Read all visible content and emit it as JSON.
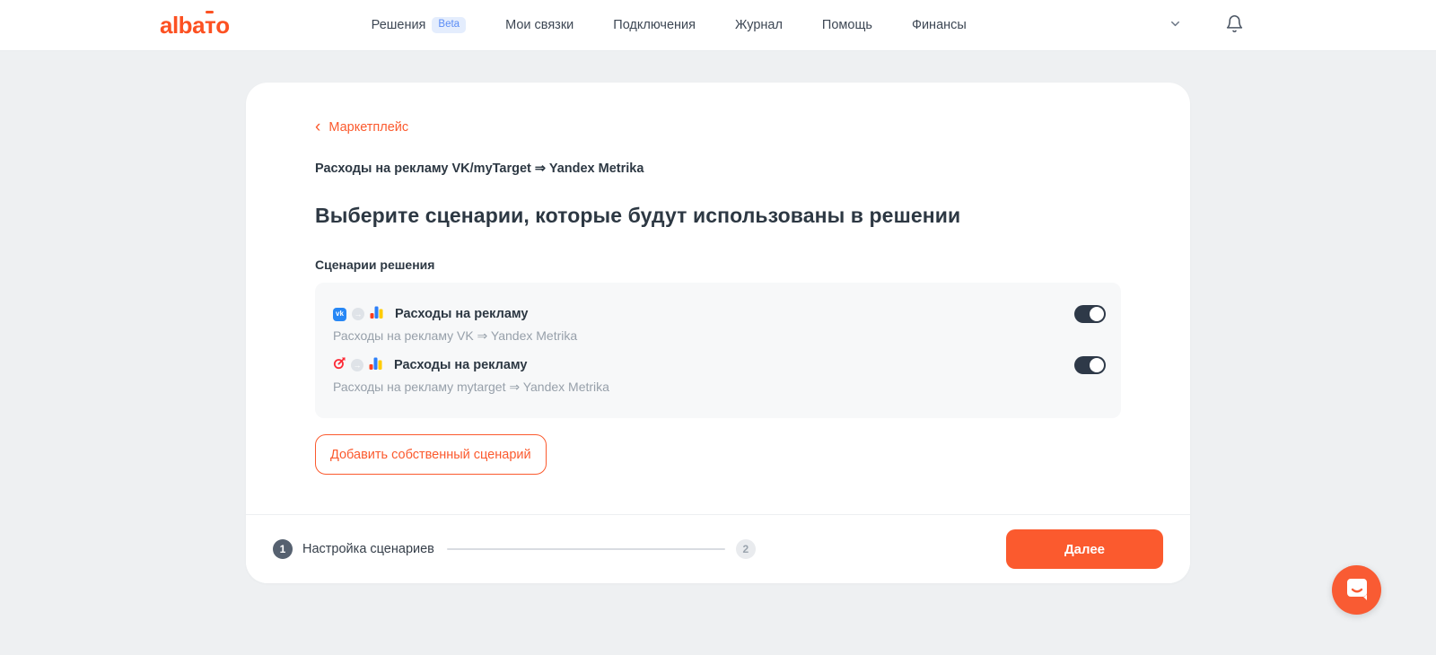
{
  "brand": {
    "logo_part1": "alba",
    "logo_t": "т",
    "logo_part2": "o"
  },
  "nav": {
    "items": [
      {
        "label": "Решения",
        "badge": "Beta"
      },
      {
        "label": "Мои связки"
      },
      {
        "label": "Подключения"
      },
      {
        "label": "Журнал"
      },
      {
        "label": "Помощь"
      },
      {
        "label": "Финансы"
      }
    ]
  },
  "page": {
    "back_label": "Маркетплейс",
    "back_chevron": "‹",
    "solution_title": "Расходы на рекламу VK/myTarget ⇒ Yandex Metrika",
    "heading": "Выберите сценарии, которые будут использованы в решении",
    "scenarios_label": "Сценарии решения",
    "scenarios": [
      {
        "source_app": "VK",
        "target_app": "Yandex Metrika",
        "title": "Расходы на рекламу",
        "subtitle": "Расходы на рекламу VK ⇒ Yandex Metrika",
        "enabled": true
      },
      {
        "source_app": "myTarget",
        "target_app": "Yandex Metrika",
        "title": "Расходы на рекламу",
        "subtitle": "Расходы на рекламу mytarget ⇒ Yandex Metrika",
        "enabled": true
      }
    ],
    "add_scenario_button": "Добавить собственный сценарий"
  },
  "footer": {
    "step1": {
      "number": "1",
      "label": "Настройка сценариев"
    },
    "step2": {
      "number": "2"
    },
    "next_button": "Далее"
  },
  "icons": {
    "vk_text": "vk",
    "transfer_arrow": "→"
  },
  "colors": {
    "accent_orange": "#fb5a2e",
    "logo_orange": "#fc5122",
    "page_background": "#eef0f2",
    "panel_background": "#f7f8f9",
    "toggle_on": "#2e3948",
    "vk_blue": "#2787f5",
    "metrika_red": "#fc3f1d",
    "metrika_blue": "#2d7ff9",
    "metrika_yellow": "#ffcc00",
    "mytarget_red": "#fc2c38",
    "beta_badge_bg": "#e4edfd",
    "beta_badge_text": "#5b8df5",
    "subtitle_gray": "#97a0aa"
  }
}
